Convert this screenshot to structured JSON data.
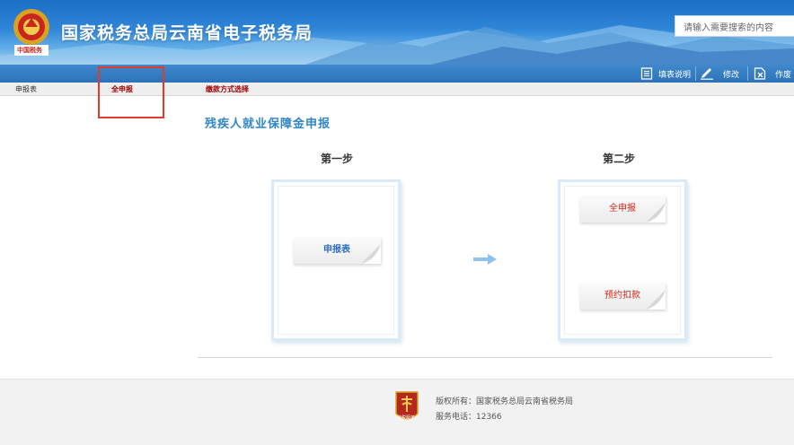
{
  "header": {
    "site_title": "国家税务总局云南省电子税务局",
    "logo_text": "中国税务",
    "search_placeholder": "请输入需要搜索的内容"
  },
  "toolbar": {
    "items": [
      {
        "label": "填表说明",
        "icon": "document-list-icon"
      },
      {
        "label": "修改",
        "icon": "pencil-icon"
      },
      {
        "label": "作废",
        "icon": "cancel-document-icon"
      }
    ]
  },
  "tabs": [
    {
      "label": "申报表",
      "style": "plain"
    },
    {
      "label": "全申报",
      "style": "red"
    },
    {
      "label": "缴款方式选择",
      "style": "red"
    }
  ],
  "main": {
    "heading": "残疾人就业保障金申报",
    "step1": {
      "title": "第一步",
      "button": "申报表"
    },
    "step2": {
      "title": "第二步",
      "buttons": [
        "全申报",
        "预约扣款"
      ]
    }
  },
  "footer": {
    "copyright": "版权所有：国家税务总局云南省税务局",
    "service_phone": "服务电话：12366",
    "logo_text": "纳税服务"
  },
  "colors": {
    "banner": "#2f86d8",
    "toolbar": "#2d72b8",
    "heading": "#2f86c8",
    "red_text": "#a00000",
    "highlight_box": "#e23a2c",
    "footer_bg": "#f2f2f2"
  }
}
